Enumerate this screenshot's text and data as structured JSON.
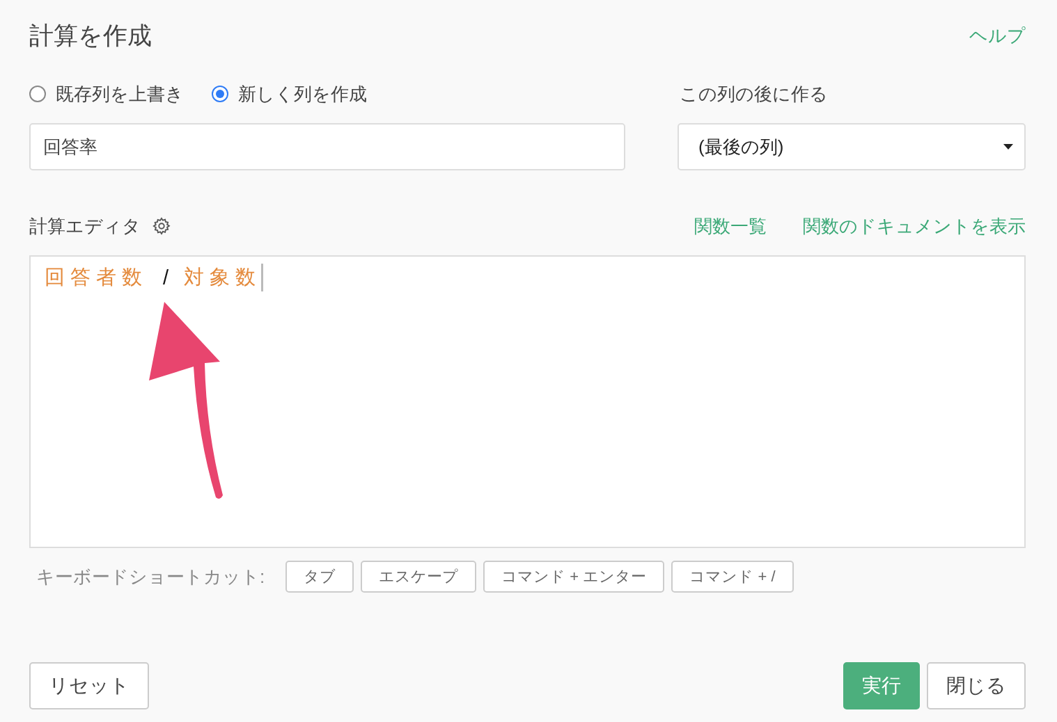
{
  "dialog": {
    "title": "計算を作成",
    "help_link": "ヘルプ"
  },
  "mode_options": [
    {
      "label": "既存列を上書き",
      "selected": false
    },
    {
      "label": "新しく列を作成",
      "selected": true
    }
  ],
  "column_name": {
    "value": "回答率"
  },
  "position": {
    "label": "この列の後に作る",
    "value": "(最後の列)"
  },
  "editor": {
    "label": "計算エディタ",
    "links": [
      "関数一覧",
      "関数のドキュメントを表示"
    ],
    "tokens": [
      {
        "kind": "column",
        "text": "回答者数"
      },
      {
        "kind": "operator",
        "text": "/"
      },
      {
        "kind": "column",
        "text": "対象数"
      }
    ]
  },
  "shortcuts": {
    "label": "キーボードショートカット:",
    "keys": [
      "タブ",
      "エスケープ",
      "コマンド + エンター",
      "コマンド + /"
    ]
  },
  "buttons": {
    "reset": "リセット",
    "run": "実行",
    "close": "閉じる"
  }
}
